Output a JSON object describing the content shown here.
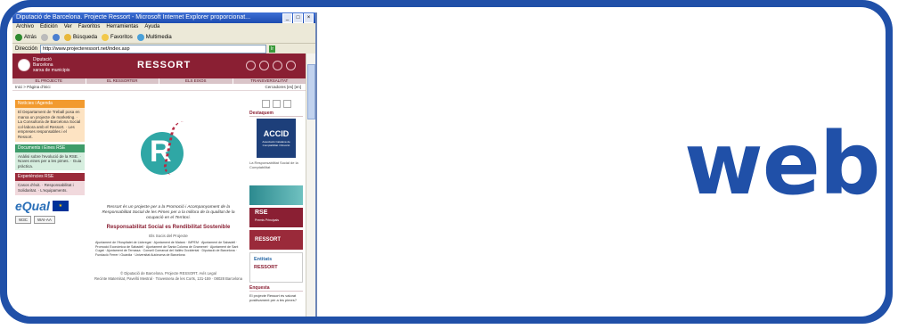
{
  "big_word": "web",
  "browser": {
    "title": "Diputació de Barcelona. Projecte Ressort - Microsoft Internet Explorer proporcionat...",
    "menu": [
      "Archivo",
      "Edición",
      "Ver",
      "Favoritos",
      "Herramientas",
      "Ayuda"
    ],
    "toolbar": {
      "back": "Atrás",
      "search": "Búsqueda",
      "favorites": "Favoritos",
      "multimedia": "Multimedia"
    },
    "address_label": "Dirección",
    "address_value": "http://www.projecteressort.net/index.asp",
    "go": "Ir"
  },
  "site": {
    "diputacio_line1": "Diputació",
    "diputacio_line2": "Barcelona",
    "diputacio_line3": "xarxa de municipis",
    "brand": "RESSORT",
    "nav": [
      "EL PROJECTE",
      "EL RESSORTER",
      "ELS EIXOS",
      "TRANSVERSALITAT"
    ],
    "breadcrumb": "Inici > Pàgina d'inici",
    "breadcrumb_right": "Cercadores        [es]  [en]",
    "left_boxes": [
      {
        "title": "Notícies i Agenda",
        "body": "El Departament de Treball posa en marxa un projecte de marketing. · La Consultoria de Barcelona Social col·labora amb el Ressort. · Les empreses responsables i el Ressort."
      },
      {
        "title": "Documents i Eines RSE",
        "body": "Anàlisi sobre l'evolució de la RSE. · Noves eines per a les pimes. · Guia pràctica."
      },
      {
        "title": "Experiències RSE",
        "body": "Casos d'èxit. · Responsabilitat i Solidaritat. · L'equipaments."
      }
    ],
    "equal": "eQual",
    "badges": [
      "W3C",
      "WAI-AA"
    ],
    "intro": "Ressort és un projecte per a la Promoció i Acompanyament de la Responsabilitat Social de les Pimes per a la millora de la qualitat de la ocupació en el Territori.",
    "tagline": "Responsabilitat Social es Rendibilitat Sostenible",
    "subtag": "Els Socis del Projecte",
    "partners": "Ajuntament de l'Hospitalet de Llobregat · Ajuntament de Mataró · IMPEM · Ajuntament de Sabadell · Promoció Econòmica de Sabadell · Ajuntament de Santa Coloma de Gramenet · Ajuntament de Sant Cugat · Ajuntament de Terrassa · Consell Comarcal del Vallès Occidental · Diputació de Barcelona · Fundació Ferrer i Guàrdia · Universitat Autònoma de Barcelona",
    "footer_line1": "© Diputació de Barcelona. Projecte RESSORT. Avís Legal",
    "footer_line2": "Recinte Maternitat, Pavelló Mestral · Travessera de les Corts, 131-159 · 08028 Barcelona",
    "right": {
      "featured_title": "Destaquem",
      "accid": "ACCID",
      "accid_sub": "Associació Catalana de Comptabilitat i Direcció",
      "note": "La Responsabilitat Social de la Comptabilitat",
      "rse_banner": "RSE",
      "rse_banner_sub": "Premis Principals",
      "ressort_banner": "RESSORT",
      "ent_banner_1": "Entitats",
      "ent_banner_2": "RESSORT",
      "poll_title": "Enquesta",
      "poll_text": "El projecte Ressort és valorat positivament per a les pimes?"
    }
  }
}
